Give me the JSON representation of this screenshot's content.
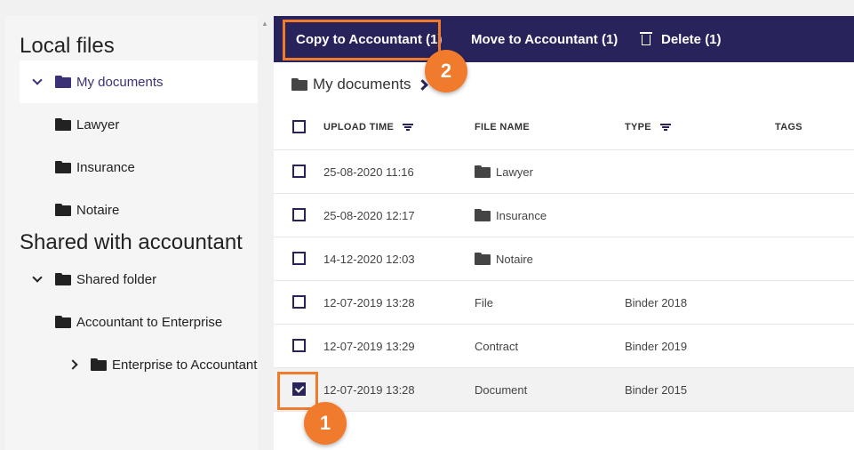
{
  "sidebar": {
    "local_title": "Local files",
    "shared_title": "Shared with accountant",
    "local_items": [
      {
        "label": "My documents"
      },
      {
        "label": "Lawyer"
      },
      {
        "label": "Insurance"
      },
      {
        "label": "Notaire"
      }
    ],
    "shared_items": [
      {
        "label": "Shared folder"
      },
      {
        "label": "Accountant to Enterprise"
      },
      {
        "label": "Enterprise to Accountant"
      }
    ]
  },
  "toolbar": {
    "copy_label": "Copy to Accountant (1)",
    "move_label": "Move to Accountant (1)",
    "delete_label": "Delete (1)"
  },
  "breadcrumb": {
    "current": "My documents"
  },
  "table": {
    "headers": {
      "upload_time": "UPLOAD TIME",
      "file_name": "FILE NAME",
      "type": "TYPE",
      "tags": "TAGS"
    },
    "rows": [
      {
        "time": "25-08-2020 11:16",
        "name": "Lawyer",
        "type": "",
        "is_folder": true,
        "checked": false
      },
      {
        "time": "25-08-2020 12:17",
        "name": "Insurance",
        "type": "",
        "is_folder": true,
        "checked": false
      },
      {
        "time": "14-12-2020 12:03",
        "name": "Notaire",
        "type": "",
        "is_folder": true,
        "checked": false
      },
      {
        "time": "12-07-2019 13:28",
        "name": "File",
        "type": "Binder 2018",
        "is_folder": false,
        "checked": false
      },
      {
        "time": "12-07-2019 13:29",
        "name": "Contract",
        "type": "Binder 2019",
        "is_folder": false,
        "checked": false
      },
      {
        "time": "12-07-2019 13:28",
        "name": "Document",
        "type": "Binder 2015",
        "is_folder": false,
        "checked": true
      }
    ]
  },
  "annotations": {
    "step1": "1",
    "step2": "2"
  },
  "colors": {
    "primary": "#29235c",
    "accent": "#f07b2d"
  }
}
